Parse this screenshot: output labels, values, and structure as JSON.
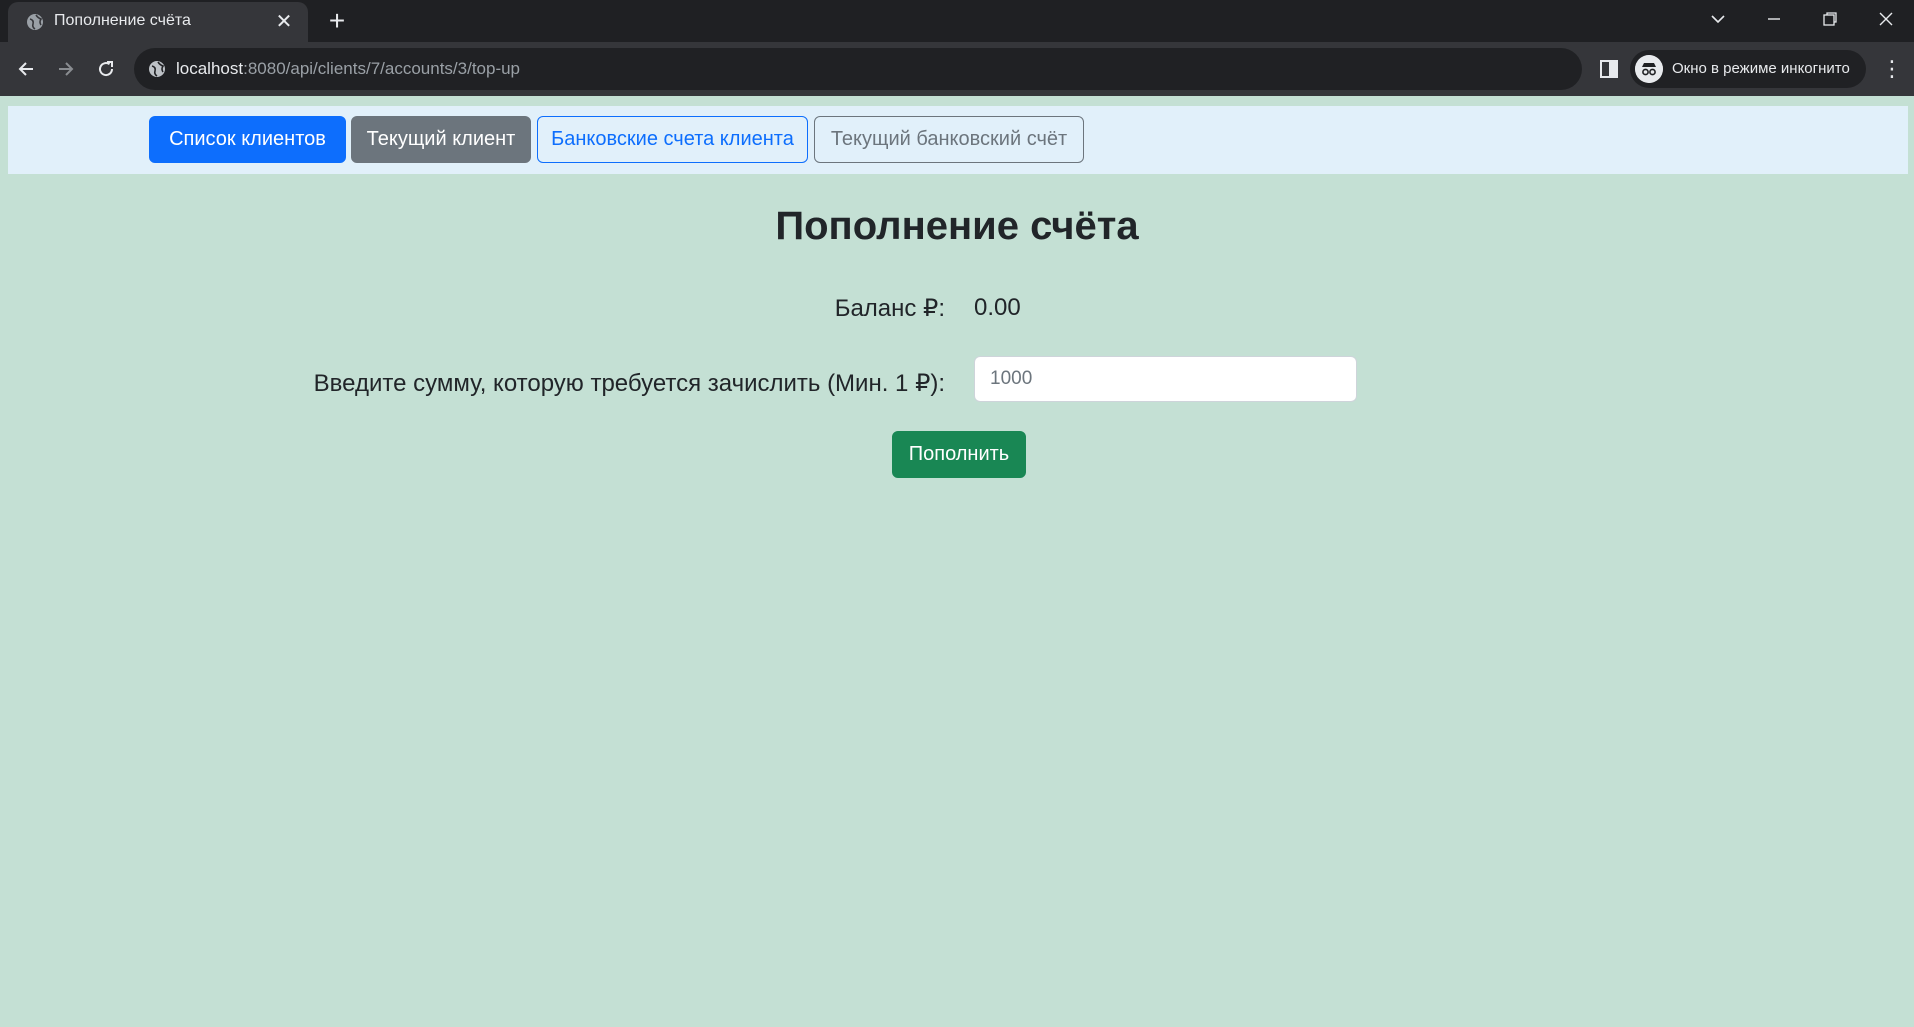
{
  "browser": {
    "tab_title": "Пополнение счёта",
    "url_host": "localhost",
    "url_rest": ":8080/api/clients/7/accounts/3/top-up",
    "incognito_label": "Окно в режиме инкогнито"
  },
  "nav": {
    "clients_list": "Список клиентов",
    "current_client": "Текущий клиент",
    "client_accounts": "Банковские счета клиента",
    "current_account": "Текущий банковский счёт"
  },
  "main": {
    "title": "Пополнение счёта",
    "balance_label": "Баланс ₽:",
    "balance_value": "0.00",
    "amount_label": "Введите сумму, которую требуется зачислить (Мин. 1 ₽):",
    "amount_placeholder": "1000",
    "submit_label": "Пополнить"
  },
  "colors": {
    "page_background": "#c4e0d4",
    "nav_background": "#e1f0fa",
    "primary": "#0d6efd",
    "secondary": "#6c757d",
    "success": "#198754"
  }
}
